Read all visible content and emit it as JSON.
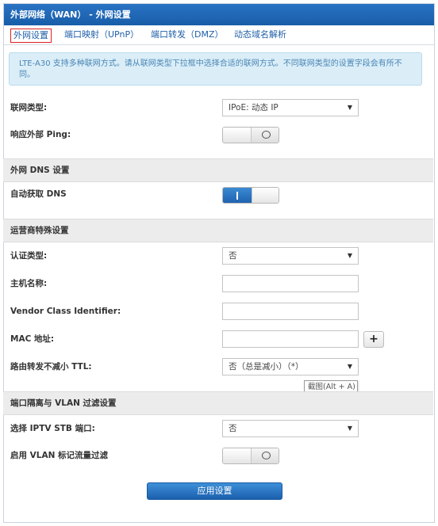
{
  "header": {
    "title": "外部网络（WAN） - 外网设置"
  },
  "tabs": [
    {
      "label": "外网设置"
    },
    {
      "label": "端口映射（UPnP）"
    },
    {
      "label": "端口转发（DMZ）"
    },
    {
      "label": "动态域名解析"
    }
  ],
  "notice": {
    "text": "LTE-A30 支持多种联网方式。请从联网类型下拉框中选择合适的联网方式。不同联网类型的设置字段会有所不同。"
  },
  "wan": {
    "connection_type_label": "联网类型:",
    "connection_type_value": "IPoE: 动态 IP",
    "ping_label": "响应外部 Ping:",
    "ping_enabled": false
  },
  "dns_section": {
    "title": "外网 DNS 设置",
    "auto_dns_label": "自动获取 DNS",
    "auto_dns_enabled": true
  },
  "isp_section": {
    "title": "运营商特殊设置",
    "auth_type_label": "认证类型:",
    "auth_type_value": "否",
    "hostname_label": "主机名称:",
    "hostname_value": "",
    "vendor_class_label": "Vendor Class Identifier:",
    "vendor_class_value": "",
    "mac_label": "MAC 地址:",
    "mac_value": "",
    "mac_add_label": "+",
    "ttl_label": "路由转发不减小 TTL:",
    "ttl_value": "否（总是减小）（*）"
  },
  "tooltip": {
    "text": "截图(Alt + A)"
  },
  "vlan_section": {
    "title": "端口隔离与 VLAN 过滤设置",
    "iptv_label": "选择 IPTV STB 端口:",
    "iptv_value": "否",
    "vlan_filter_label": "启用 VLAN 标记流量过滤",
    "vlan_filter_enabled": false
  },
  "actions": {
    "apply_label": "应用设置"
  },
  "colors": {
    "accent": "#1f63b0",
    "notice_bg": "#dbeef8",
    "active_tab_border": "#e02020"
  }
}
